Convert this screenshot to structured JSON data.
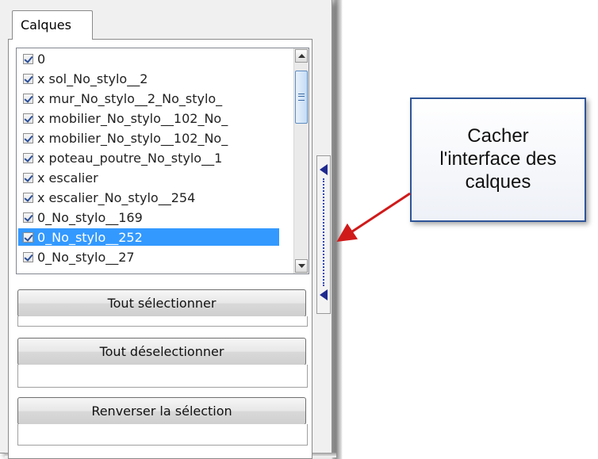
{
  "panel": {
    "tab_label": "Calques",
    "layers": [
      {
        "label": "0",
        "checked": true,
        "selected": false
      },
      {
        "label": "x sol_No_stylo__2",
        "checked": true,
        "selected": false
      },
      {
        "label": "x mur_No_stylo__2_No_stylo_",
        "checked": true,
        "selected": false
      },
      {
        "label": "x mobilier_No_stylo__102_No_",
        "checked": true,
        "selected": false
      },
      {
        "label": "x mobilier_No_stylo__102_No_",
        "checked": true,
        "selected": false
      },
      {
        "label": "x poteau_poutre_No_stylo__1",
        "checked": true,
        "selected": false
      },
      {
        "label": "x escalier",
        "checked": true,
        "selected": false
      },
      {
        "label": "x escalier_No_stylo__254",
        "checked": true,
        "selected": false
      },
      {
        "label": "0_No_stylo__169",
        "checked": true,
        "selected": false
      },
      {
        "label": "0_No_stylo__252",
        "checked": true,
        "selected": true
      },
      {
        "label": "0_No_stylo__27",
        "checked": true,
        "selected": false
      }
    ],
    "buttons": {
      "select_all": "Tout sélectionner",
      "deselect_all": "Tout déselectionner",
      "invert_selection": "Renverser la sélection"
    }
  },
  "callout": {
    "text": "Cacher\nl'interface des\ncalques"
  },
  "colors": {
    "selection": "#3399ff",
    "arrow": "#d01a1a",
    "callout_border": "#2f5597"
  }
}
